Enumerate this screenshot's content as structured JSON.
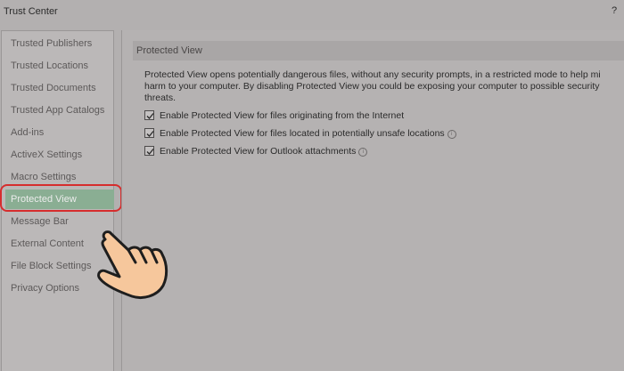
{
  "window": {
    "title": "Trust Center",
    "help_label": "?"
  },
  "sidebar": {
    "items": [
      {
        "label": "Trusted Publishers"
      },
      {
        "label": "Trusted Locations"
      },
      {
        "label": "Trusted Documents"
      },
      {
        "label": "Trusted App Catalogs"
      },
      {
        "label": "Add-ins"
      },
      {
        "label": "ActiveX Settings"
      },
      {
        "label": "Macro Settings"
      },
      {
        "label": "Protected View",
        "selected": true
      },
      {
        "label": "Message Bar"
      },
      {
        "label": "External Content"
      },
      {
        "label": "File Block Settings"
      },
      {
        "label": "Privacy Options"
      }
    ]
  },
  "main": {
    "section_title": "Protected View",
    "description": "Protected View opens potentially dangerous files, without any security prompts, in a restricted mode to help mi\nharm to your computer. By disabling Protected View you could be exposing your computer to possible security\nthreats.",
    "options": [
      {
        "label": "Enable Protected View for files originating from the Internet",
        "checked": true,
        "info": false
      },
      {
        "label": "Enable Protected View for files located in potentially unsafe locations",
        "checked": true,
        "info": true
      },
      {
        "label": "Enable Protected View for Outlook attachments",
        "checked": true,
        "info": true
      }
    ]
  },
  "overlay": {
    "highlight_color": "#d62d2d",
    "pointer_icon": "pointing-hand-icon"
  },
  "colors": {
    "selected_item_bg": "#8aae93",
    "background": "#b3b0b0"
  }
}
